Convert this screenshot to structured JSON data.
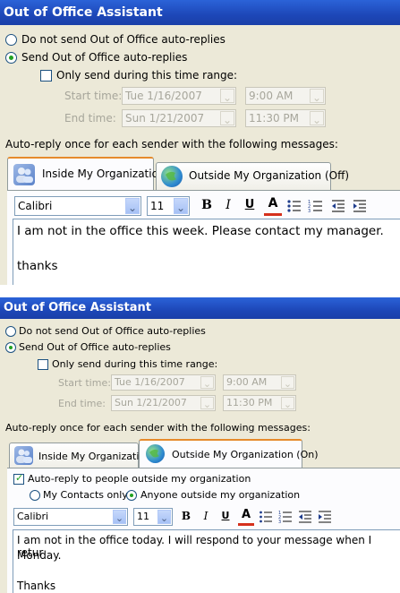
{
  "panel1": {
    "title": "Out of Office Assistant",
    "radio_no": "Do not send Out of Office auto-replies",
    "radio_yes": "Send Out of Office auto-replies",
    "only_range": "Only send during this time range:",
    "start_label": "Start time:",
    "start_date": "Tue 1/16/2007",
    "start_time": "9:00 AM",
    "end_label": "End time:",
    "end_date": "Sun 1/21/2007",
    "end_time": "11:30 PM",
    "autoreply_label": "Auto-reply once for each sender with the following messages:",
    "tab_inside": "Inside My Organization",
    "tab_outside": "Outside My Organization (Off)",
    "font": "Calibri",
    "size": "11",
    "message_line1": "I am not in the office this week. Please contact my manager.",
    "message_line2": "thanks"
  },
  "panel2": {
    "title": "Out of Office Assistant",
    "radio_no": "Do not send Out of Office auto-replies",
    "radio_yes": "Send Out of Office auto-replies",
    "only_range": "Only send during this time range:",
    "start_label": "Start time:",
    "start_date": "Tue 1/16/2007",
    "start_time": "9:00 AM",
    "end_label": "End time:",
    "end_date": "Sun 1/21/2007",
    "end_time": "11:30 PM",
    "autoreply_label": "Auto-reply once for each sender with the following messages:",
    "tab_inside": "Inside My Organization",
    "tab_outside": "Outside My Organization (On)",
    "autoreply_outside": "Auto-reply to people outside my organization",
    "contacts_only": "My Contacts only",
    "anyone_outside": "Anyone outside my organization",
    "font": "Calibri",
    "size": "11",
    "message_line1": "I am not in the office today. I will respond to your message when I retur",
    "message_line2": "Monday.",
    "message_line3": "Thanks"
  },
  "toolbar": {
    "bold": "B",
    "italic": "I",
    "underline": "U",
    "font_color": "A",
    "arrow": "⌄"
  },
  "colors": {
    "title_bar": "#1d47b8",
    "dialog_bg": "#ece9d8",
    "selected_tab_accent": "#e68b2c",
    "radio_dot": "#21a121",
    "font_color_underline": "#d5301c"
  },
  "icons": [
    "users-icon",
    "globe-icon",
    "bullets-icon",
    "numbering-icon",
    "decrease-indent-icon",
    "increase-indent-icon",
    "dropdown-arrow-icon"
  ]
}
